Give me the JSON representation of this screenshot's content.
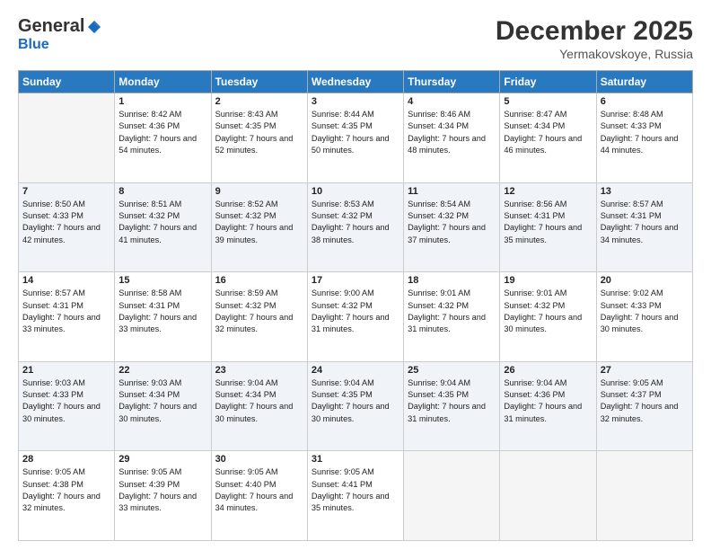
{
  "header": {
    "logo_general": "General",
    "logo_blue": "Blue",
    "month": "December 2025",
    "location": "Yermakovskoye, Russia"
  },
  "days_of_week": [
    "Sunday",
    "Monday",
    "Tuesday",
    "Wednesday",
    "Thursday",
    "Friday",
    "Saturday"
  ],
  "weeks": [
    [
      {
        "day": "",
        "empty": true
      },
      {
        "day": "1",
        "sunrise": "Sunrise: 8:42 AM",
        "sunset": "Sunset: 4:36 PM",
        "daylight": "Daylight: 7 hours and 54 minutes."
      },
      {
        "day": "2",
        "sunrise": "Sunrise: 8:43 AM",
        "sunset": "Sunset: 4:35 PM",
        "daylight": "Daylight: 7 hours and 52 minutes."
      },
      {
        "day": "3",
        "sunrise": "Sunrise: 8:44 AM",
        "sunset": "Sunset: 4:35 PM",
        "daylight": "Daylight: 7 hours and 50 minutes."
      },
      {
        "day": "4",
        "sunrise": "Sunrise: 8:46 AM",
        "sunset": "Sunset: 4:34 PM",
        "daylight": "Daylight: 7 hours and 48 minutes."
      },
      {
        "day": "5",
        "sunrise": "Sunrise: 8:47 AM",
        "sunset": "Sunset: 4:34 PM",
        "daylight": "Daylight: 7 hours and 46 minutes."
      },
      {
        "day": "6",
        "sunrise": "Sunrise: 8:48 AM",
        "sunset": "Sunset: 4:33 PM",
        "daylight": "Daylight: 7 hours and 44 minutes."
      }
    ],
    [
      {
        "day": "7",
        "sunrise": "Sunrise: 8:50 AM",
        "sunset": "Sunset: 4:33 PM",
        "daylight": "Daylight: 7 hours and 42 minutes."
      },
      {
        "day": "8",
        "sunrise": "Sunrise: 8:51 AM",
        "sunset": "Sunset: 4:32 PM",
        "daylight": "Daylight: 7 hours and 41 minutes."
      },
      {
        "day": "9",
        "sunrise": "Sunrise: 8:52 AM",
        "sunset": "Sunset: 4:32 PM",
        "daylight": "Daylight: 7 hours and 39 minutes."
      },
      {
        "day": "10",
        "sunrise": "Sunrise: 8:53 AM",
        "sunset": "Sunset: 4:32 PM",
        "daylight": "Daylight: 7 hours and 38 minutes."
      },
      {
        "day": "11",
        "sunrise": "Sunrise: 8:54 AM",
        "sunset": "Sunset: 4:32 PM",
        "daylight": "Daylight: 7 hours and 37 minutes."
      },
      {
        "day": "12",
        "sunrise": "Sunrise: 8:56 AM",
        "sunset": "Sunset: 4:31 PM",
        "daylight": "Daylight: 7 hours and 35 minutes."
      },
      {
        "day": "13",
        "sunrise": "Sunrise: 8:57 AM",
        "sunset": "Sunset: 4:31 PM",
        "daylight": "Daylight: 7 hours and 34 minutes."
      }
    ],
    [
      {
        "day": "14",
        "sunrise": "Sunrise: 8:57 AM",
        "sunset": "Sunset: 4:31 PM",
        "daylight": "Daylight: 7 hours and 33 minutes."
      },
      {
        "day": "15",
        "sunrise": "Sunrise: 8:58 AM",
        "sunset": "Sunset: 4:31 PM",
        "daylight": "Daylight: 7 hours and 33 minutes."
      },
      {
        "day": "16",
        "sunrise": "Sunrise: 8:59 AM",
        "sunset": "Sunset: 4:32 PM",
        "daylight": "Daylight: 7 hours and 32 minutes."
      },
      {
        "day": "17",
        "sunrise": "Sunrise: 9:00 AM",
        "sunset": "Sunset: 4:32 PM",
        "daylight": "Daylight: 7 hours and 31 minutes."
      },
      {
        "day": "18",
        "sunrise": "Sunrise: 9:01 AM",
        "sunset": "Sunset: 4:32 PM",
        "daylight": "Daylight: 7 hours and 31 minutes."
      },
      {
        "day": "19",
        "sunrise": "Sunrise: 9:01 AM",
        "sunset": "Sunset: 4:32 PM",
        "daylight": "Daylight: 7 hours and 30 minutes."
      },
      {
        "day": "20",
        "sunrise": "Sunrise: 9:02 AM",
        "sunset": "Sunset: 4:33 PM",
        "daylight": "Daylight: 7 hours and 30 minutes."
      }
    ],
    [
      {
        "day": "21",
        "sunrise": "Sunrise: 9:03 AM",
        "sunset": "Sunset: 4:33 PM",
        "daylight": "Daylight: 7 hours and 30 minutes."
      },
      {
        "day": "22",
        "sunrise": "Sunrise: 9:03 AM",
        "sunset": "Sunset: 4:34 PM",
        "daylight": "Daylight: 7 hours and 30 minutes."
      },
      {
        "day": "23",
        "sunrise": "Sunrise: 9:04 AM",
        "sunset": "Sunset: 4:34 PM",
        "daylight": "Daylight: 7 hours and 30 minutes."
      },
      {
        "day": "24",
        "sunrise": "Sunrise: 9:04 AM",
        "sunset": "Sunset: 4:35 PM",
        "daylight": "Daylight: 7 hours and 30 minutes."
      },
      {
        "day": "25",
        "sunrise": "Sunrise: 9:04 AM",
        "sunset": "Sunset: 4:35 PM",
        "daylight": "Daylight: 7 hours and 31 minutes."
      },
      {
        "day": "26",
        "sunrise": "Sunrise: 9:04 AM",
        "sunset": "Sunset: 4:36 PM",
        "daylight": "Daylight: 7 hours and 31 minutes."
      },
      {
        "day": "27",
        "sunrise": "Sunrise: 9:05 AM",
        "sunset": "Sunset: 4:37 PM",
        "daylight": "Daylight: 7 hours and 32 minutes."
      }
    ],
    [
      {
        "day": "28",
        "sunrise": "Sunrise: 9:05 AM",
        "sunset": "Sunset: 4:38 PM",
        "daylight": "Daylight: 7 hours and 32 minutes."
      },
      {
        "day": "29",
        "sunrise": "Sunrise: 9:05 AM",
        "sunset": "Sunset: 4:39 PM",
        "daylight": "Daylight: 7 hours and 33 minutes."
      },
      {
        "day": "30",
        "sunrise": "Sunrise: 9:05 AM",
        "sunset": "Sunset: 4:40 PM",
        "daylight": "Daylight: 7 hours and 34 minutes."
      },
      {
        "day": "31",
        "sunrise": "Sunrise: 9:05 AM",
        "sunset": "Sunset: 4:41 PM",
        "daylight": "Daylight: 7 hours and 35 minutes."
      },
      {
        "day": "",
        "empty": true
      },
      {
        "day": "",
        "empty": true
      },
      {
        "day": "",
        "empty": true
      }
    ]
  ]
}
